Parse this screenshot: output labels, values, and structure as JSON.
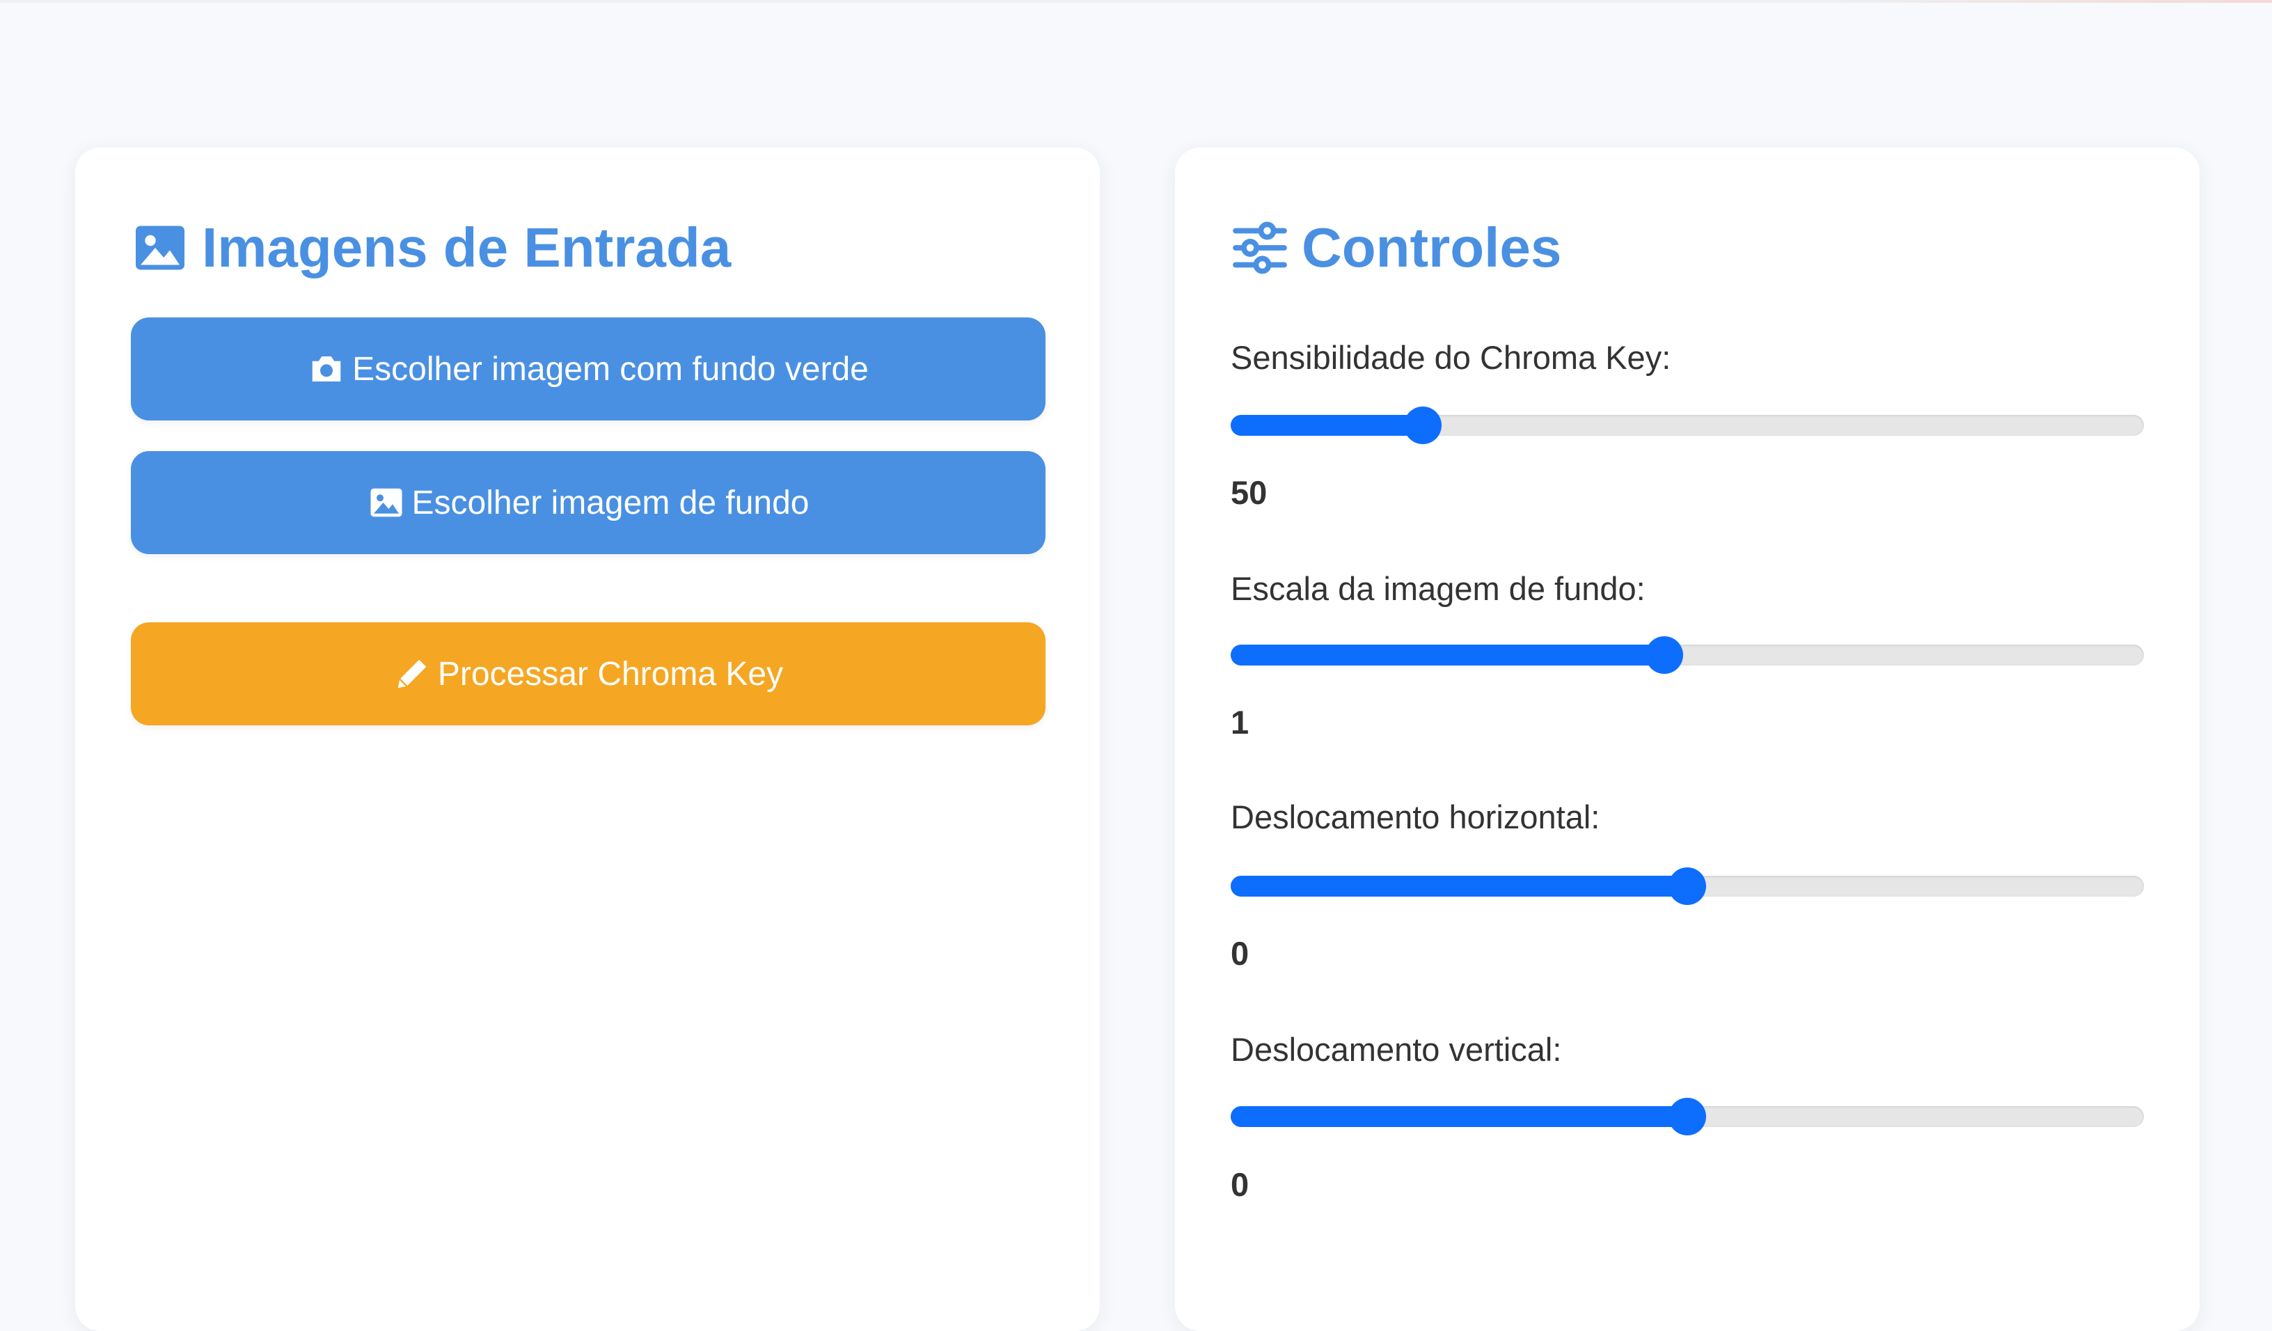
{
  "colors": {
    "accent": "#4a90e2",
    "process_button": "#f5a623",
    "slider_fill": "#0d6efd",
    "slider_track": "#e6e6e6",
    "text": "#333333"
  },
  "input_panel": {
    "title": "Imagens de Entrada",
    "title_icon": "image-icon",
    "buttons": [
      {
        "label": "Escolher imagem com fundo verde",
        "icon": "camera-icon"
      },
      {
        "label": "Escolher imagem de fundo",
        "icon": "image-icon"
      },
      {
        "label": "Processar Chroma Key",
        "icon": "pencil-icon"
      }
    ]
  },
  "controls_panel": {
    "title": "Controles",
    "title_icon": "sliders-icon",
    "sliders": [
      {
        "label": "Sensibilidade do Chroma Key:",
        "value": "50",
        "fraction": 0.21
      },
      {
        "label": "Escala da imagem de fundo:",
        "value": "1",
        "fraction": 0.475
      },
      {
        "label": "Deslocamento horizontal:",
        "value": "0",
        "fraction": 0.5
      },
      {
        "label": "Deslocamento vertical:",
        "value": "0",
        "fraction": 0.5
      }
    ]
  }
}
